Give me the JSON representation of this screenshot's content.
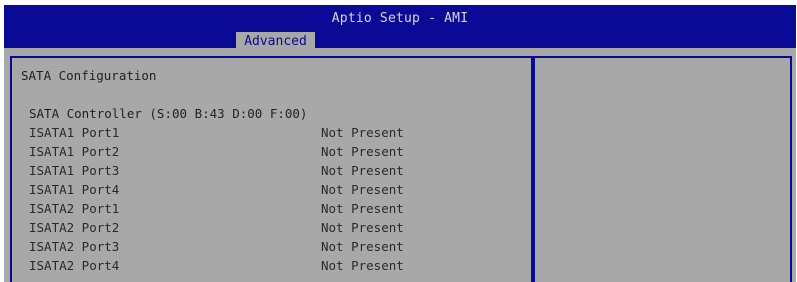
{
  "header": {
    "title": "Aptio Setup - AMI",
    "tab_label": "Advanced"
  },
  "main": {
    "section_title": "SATA Configuration",
    "controller_label": "SATA Controller (S:00 B:43 D:00 F:00)",
    "ports": [
      {
        "label": "ISATA1 Port1",
        "value": "Not Present"
      },
      {
        "label": "ISATA1 Port2",
        "value": "Not Present"
      },
      {
        "label": "ISATA1 Port3",
        "value": "Not Present"
      },
      {
        "label": "ISATA1 Port4",
        "value": "Not Present"
      },
      {
        "label": "ISATA2 Port1",
        "value": "Not Present"
      },
      {
        "label": "ISATA2 Port2",
        "value": "Not Present"
      },
      {
        "label": "ISATA2 Port3",
        "value": "Not Present"
      },
      {
        "label": "ISATA2 Port4",
        "value": "Not Present"
      }
    ]
  },
  "colors": {
    "header_blue": "#0a0a96",
    "panel_gray": "#a8a8a8",
    "text_dark": "#222222",
    "title_text": "#d8d8d8"
  }
}
